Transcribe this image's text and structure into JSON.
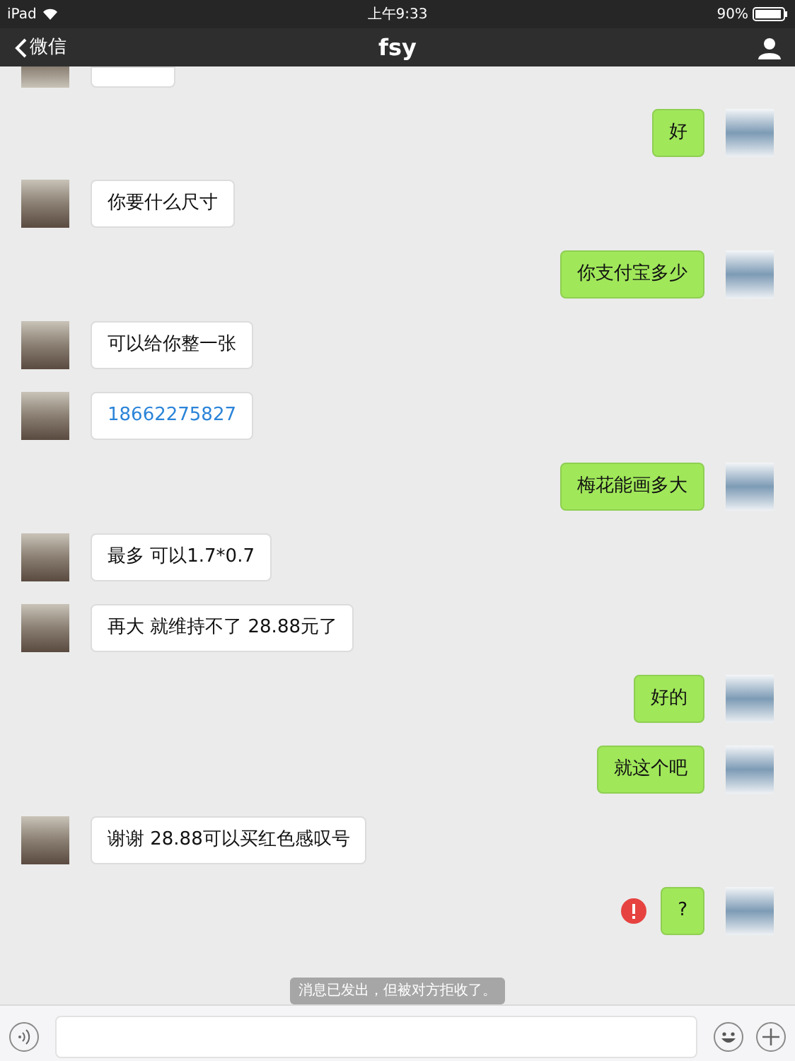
{
  "status_bar": {
    "device": "iPad",
    "time": "上午9:33",
    "battery": "90%"
  },
  "nav": {
    "back": "微信",
    "title": "fsy"
  },
  "messages": [
    {
      "kind": "received_cut"
    },
    {
      "kind": "sent",
      "text": "好",
      "failed": false
    },
    {
      "kind": "received",
      "text": "你要什么尺寸",
      "failed": false
    },
    {
      "kind": "sent",
      "text": "你支付宝多少",
      "failed": false
    },
    {
      "kind": "received",
      "text": "可以给你整一张",
      "failed": false
    },
    {
      "kind": "received_link",
      "text": "18662275827",
      "failed": false
    },
    {
      "kind": "sent",
      "text": "梅花能画多大",
      "failed": false
    },
    {
      "kind": "received",
      "text": "最多 可以1.7*0.7",
      "failed": false
    },
    {
      "kind": "received",
      "text": "再大 就维持不了 28.88元了",
      "failed": false
    },
    {
      "kind": "sent",
      "text": "好的",
      "failed": false
    },
    {
      "kind": "sent",
      "text": "就这个吧",
      "failed": false
    },
    {
      "kind": "received",
      "text": "谢谢 28.88可以买红色感叹号",
      "failed": false
    },
    {
      "kind": "sent",
      "text": "?",
      "failed": true
    }
  ],
  "notice": "消息已发出，但被对方拒收了。"
}
